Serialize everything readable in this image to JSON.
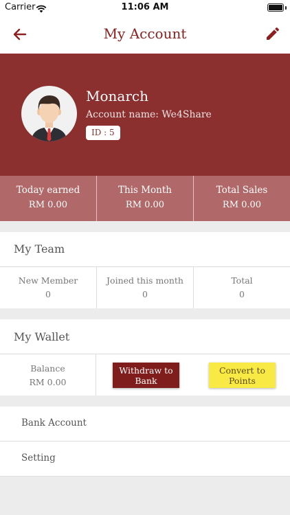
{
  "status_bar": {
    "carrier": "Carrier",
    "time": "11:06 AM"
  },
  "nav": {
    "title": "My Account",
    "back_icon": "arrow-left-icon",
    "edit_icon": "pencil-icon",
    "accent_color": "#8b2020"
  },
  "profile": {
    "name": "Monarch",
    "account_name": "Account name: We4Share",
    "id_badge": "ID : 5",
    "header_color": "#8b2f2f"
  },
  "stats": [
    {
      "label": "Today earned",
      "value": "RM 0.00"
    },
    {
      "label": "This Month",
      "value": "RM 0.00"
    },
    {
      "label": "Total Sales",
      "value": "RM 0.00"
    }
  ],
  "team": {
    "title": "My Team",
    "cells": [
      {
        "label": "New Member",
        "value": "0"
      },
      {
        "label": "Joined this month",
        "value": "0"
      },
      {
        "label": "Total",
        "value": "0"
      }
    ]
  },
  "wallet": {
    "title": "My Wallet",
    "balance_label": "Balance",
    "balance_value": "RM 0.00",
    "withdraw_line1": "Withdraw to",
    "withdraw_line2": "Bank",
    "convert_line1": "Convert to",
    "convert_line2": "Points",
    "withdraw_color": "#7f1c1c",
    "convert_color": "#f8e945"
  },
  "menu": {
    "bank_account": "Bank Account",
    "setting": "Setting"
  }
}
